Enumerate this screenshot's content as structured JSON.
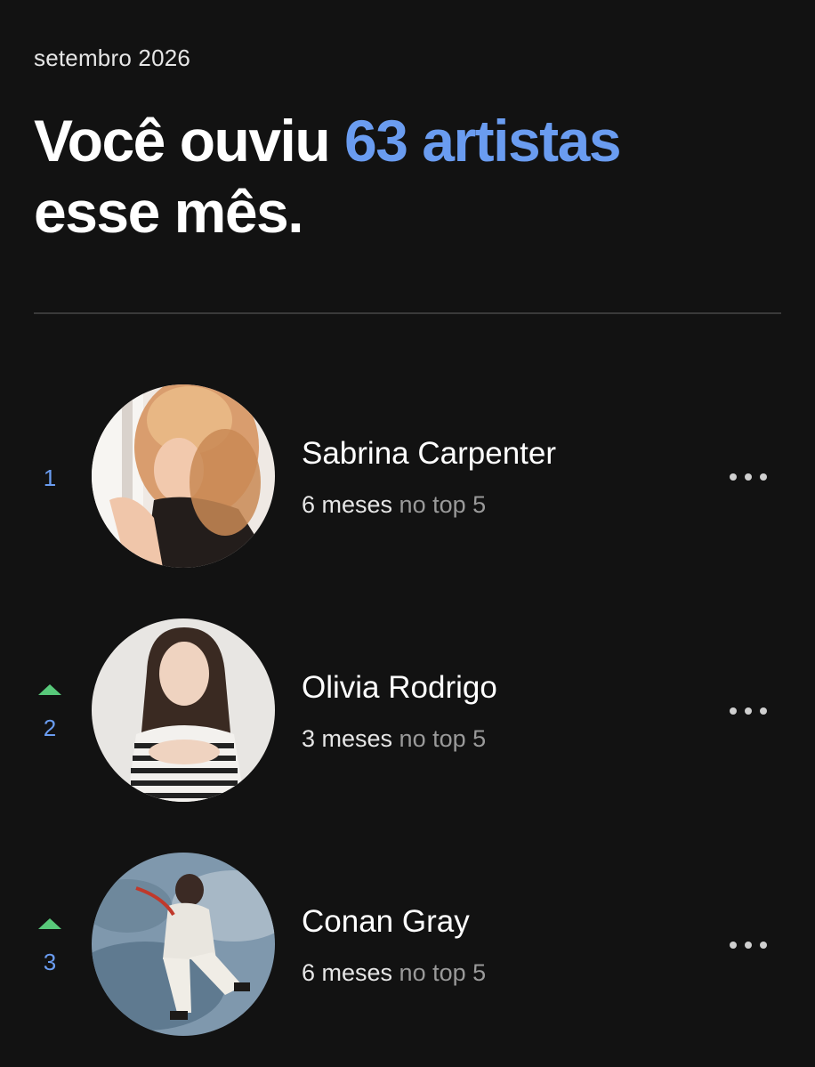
{
  "header": {
    "month": "setembro 2026",
    "headline_prefix": "Você ouviu ",
    "headline_accent": "63 artistas",
    "headline_suffix": "esse mês."
  },
  "colors": {
    "background": "#121212",
    "accent": "#6a9cf0",
    "up_arrow": "#58c97a",
    "secondary_text": "#9a9a9a"
  },
  "artists": [
    {
      "rank": "1",
      "trend": "none",
      "name": "Sabrina Carpenter",
      "months": "6 meses",
      "suffix": " no top 5",
      "more_icon": "more-horizontal-icon"
    },
    {
      "rank": "2",
      "trend": "up",
      "name": "Olivia Rodrigo",
      "months": "3 meses",
      "suffix": " no top 5",
      "more_icon": "more-horizontal-icon"
    },
    {
      "rank": "3",
      "trend": "up",
      "name": "Conan Gray",
      "months": "6 meses",
      "suffix": " no top 5",
      "more_icon": "more-horizontal-icon"
    }
  ]
}
